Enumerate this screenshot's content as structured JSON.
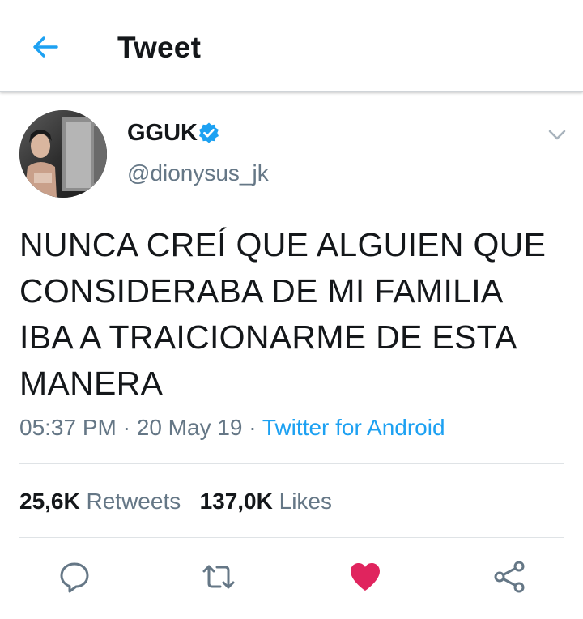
{
  "header": {
    "title": "Tweet",
    "back_icon": "arrow-left-icon"
  },
  "tweet": {
    "author": {
      "display_name": "GGUK",
      "handle": "@dionysus_jk",
      "verified": true
    },
    "text_lines": [
      "NUNCA CREÍ QUE ALGUIEN QUE",
      "CONSIDERABA DE MI FAMILIA",
      "IBA A TRAICIONARME DE ESTA",
      "MANERA"
    ],
    "time": "05:37 PM",
    "separator": " · ",
    "date": "20 May 19",
    "source": "Twitter for Android",
    "retweets_count": "25,6K",
    "retweets_label": "Retweets",
    "likes_count": "137,0K",
    "likes_label": "Likes"
  },
  "actions": [
    {
      "name": "reply",
      "icon": "speech-bubble-icon"
    },
    {
      "name": "retweet",
      "icon": "retweet-icon"
    },
    {
      "name": "like",
      "icon": "heart-icon",
      "active": true
    },
    {
      "name": "share",
      "icon": "share-icon"
    }
  ],
  "colors": {
    "accent": "#1da1f2",
    "like_active": "#e0245e",
    "secondary_text": "#657786",
    "primary_text": "#14171a"
  }
}
